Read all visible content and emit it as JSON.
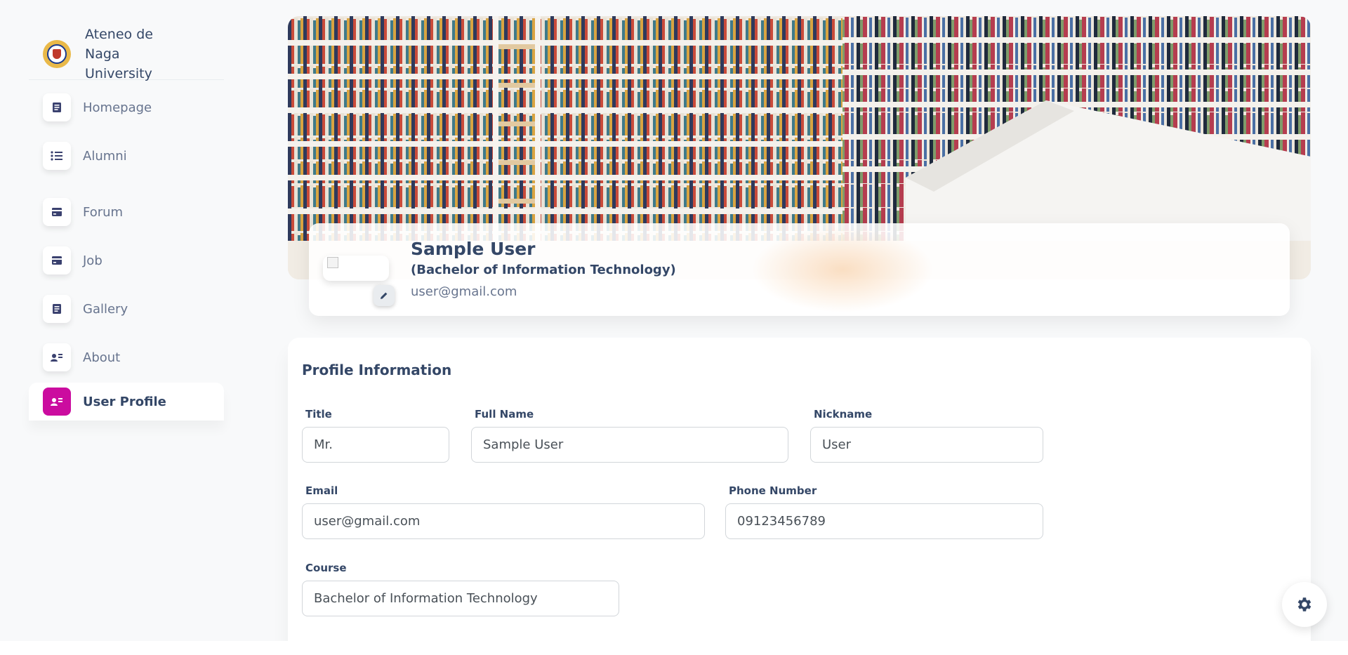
{
  "brand": {
    "name": "Ateneo de Naga University"
  },
  "sidebar": {
    "items": [
      {
        "label": "Homepage",
        "icon": "document-icon"
      },
      {
        "label": "Alumni",
        "icon": "list-icon"
      },
      {
        "label": "Forum",
        "icon": "card-icon"
      },
      {
        "label": "Job",
        "icon": "card-icon"
      },
      {
        "label": "Gallery",
        "icon": "document-icon"
      },
      {
        "label": "About",
        "icon": "user-card-icon"
      },
      {
        "label": "User Profile",
        "icon": "user-card-icon",
        "active": true
      }
    ]
  },
  "profile": {
    "name": "Sample User",
    "course": "(Bachelor of Information Technology)",
    "email": "user@gmail.com"
  },
  "info": {
    "title": "Profile Information",
    "fields": {
      "title": {
        "label": "Title",
        "value": "Mr."
      },
      "full_name": {
        "label": "Full Name",
        "value": "Sample User"
      },
      "nickname": {
        "label": "Nickname",
        "value": "User"
      },
      "email": {
        "label": "Email",
        "value": "user@gmail.com"
      },
      "phone": {
        "label": "Phone Number",
        "value": "09123456789"
      },
      "course": {
        "label": "Course",
        "value": "Bachelor of Information Technology"
      }
    }
  },
  "colors": {
    "accent": "#cb0c9f",
    "text": "#344767",
    "muted": "#67748e"
  }
}
